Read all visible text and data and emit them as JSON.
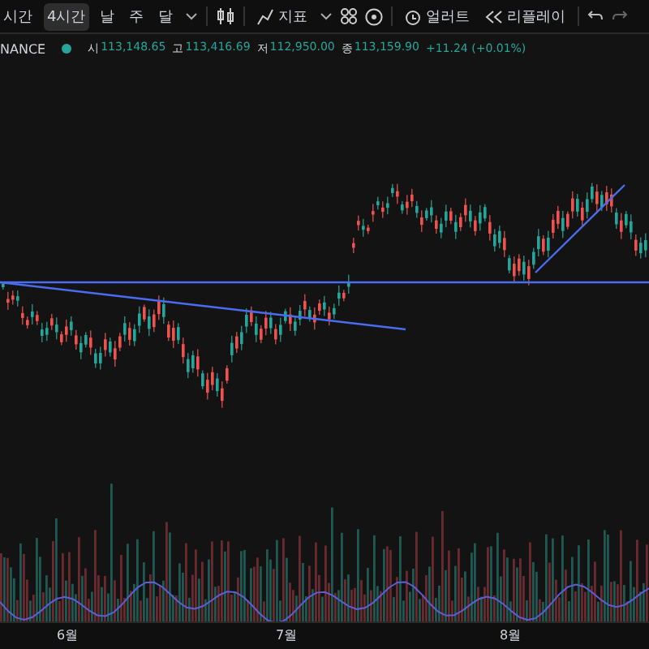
{
  "toolbar": {
    "intervals": [
      {
        "label": "시간",
        "selected": false
      },
      {
        "label": "4시간",
        "selected": true
      },
      {
        "label": "날",
        "selected": false
      },
      {
        "label": "주",
        "selected": false
      },
      {
        "label": "달",
        "selected": false
      }
    ],
    "indicators_label": "지표",
    "alert_label": "얼러트",
    "replay_label": "리플레이"
  },
  "legend": {
    "symbol": "NANCE",
    "values": [
      {
        "label": "시",
        "value": "113,148.65"
      },
      {
        "label": "고",
        "value": "113,416.69"
      },
      {
        "label": "저",
        "value": "112,950.00"
      },
      {
        "label": "종",
        "value": "113,159.90"
      }
    ],
    "change": "+11.24 (+0.01%)"
  },
  "x_axis": {
    "labels": [
      "6월",
      "7월",
      "8월"
    ]
  }
}
